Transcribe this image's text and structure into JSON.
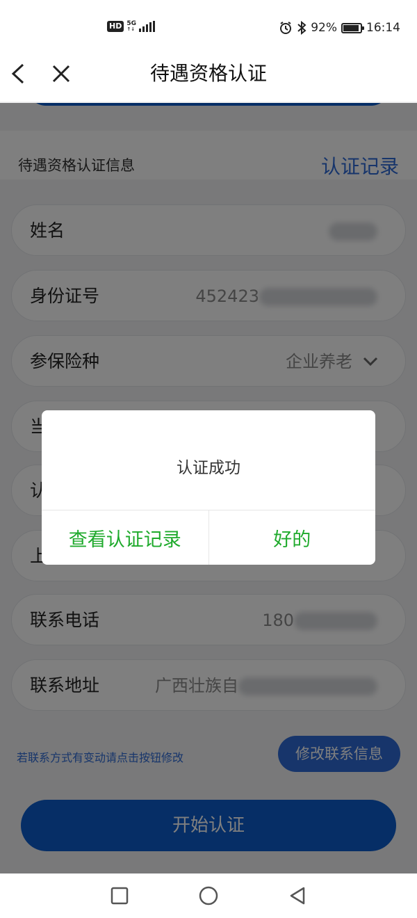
{
  "status_bar": {
    "hd": "HD",
    "network": "5G",
    "battery_percent": "92%",
    "battery_level": 0.92,
    "time": "16:14"
  },
  "header": {
    "title": "待遇资格认证",
    "back_icon": "chevron-left-icon",
    "close_icon": "close-icon"
  },
  "section": {
    "title": "待遇资格认证信息",
    "records_link": "认证记录"
  },
  "fields": [
    {
      "label": "姓名",
      "value": ""
    },
    {
      "label": "身份证号",
      "value": "452423"
    },
    {
      "label": "参保险种",
      "value": "企业养老"
    },
    {
      "label": "当",
      "value": ""
    },
    {
      "label": "认",
      "value": ""
    },
    {
      "label": "上",
      "value": ""
    },
    {
      "label": "联系电话",
      "value": "180"
    },
    {
      "label": "联系地址",
      "value": "广西壮族自"
    }
  ],
  "contact": {
    "hint": "若联系方式有变动请点击按钮修改",
    "edit_button": "修改联系信息"
  },
  "start_button": "开始认证",
  "dialog": {
    "message": "认证成功",
    "view_records": "查看认证记录",
    "ok": "好的"
  },
  "colors": {
    "primary_blue": "#0d5ccc",
    "link_blue": "#2f6bd6",
    "dialog_green": "#1faa2c"
  },
  "nav": {
    "recent_icon": "square-icon",
    "home_icon": "circle-icon",
    "back_icon": "triangle-back-icon"
  }
}
